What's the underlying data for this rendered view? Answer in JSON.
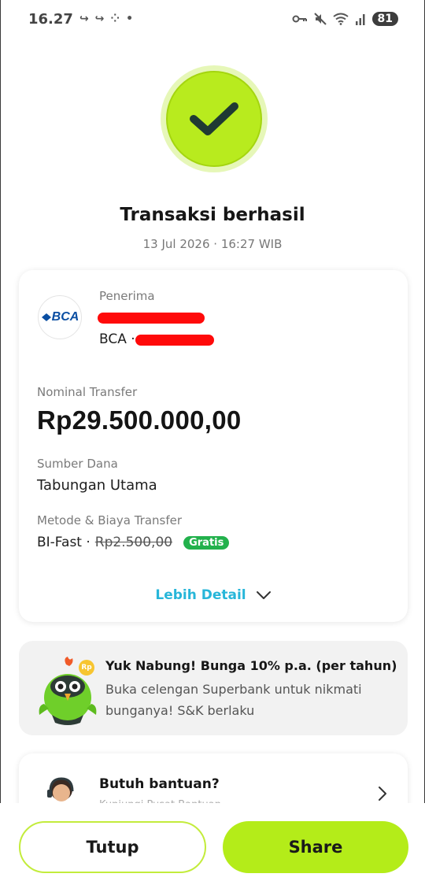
{
  "status_bar": {
    "time": "16.27",
    "battery": "81"
  },
  "result": {
    "title": "Transaksi berhasil",
    "datetime": "13 Jul 2026 · 16:27 WIB"
  },
  "recipient": {
    "label": "Penerima",
    "bank_logo_text": "BCA",
    "bank_prefix": "BCA ·"
  },
  "transfer": {
    "amount_label": "Nominal Transfer",
    "amount": "Rp29.500.000,00",
    "source_label": "Sumber Dana",
    "source": "Tabungan Utama",
    "method_label": "Metode & Biaya Transfer",
    "method": "BI-Fast ·",
    "fee_original": "Rp2.500,00",
    "fee_badge": "Gratis",
    "more_detail": "Lebih Detail"
  },
  "promo": {
    "title": "Yuk Nabung! Bunga 10% p.a. (per tahun)",
    "body": "Buka celengan Superbank untuk nikmati bunganya! S&K berlaku",
    "badge": "Rp"
  },
  "help": {
    "title": "Butuh bantuan?",
    "subtitle": "Kunjungi Pusat Bantuan"
  },
  "actions": {
    "close_label": "Tutup",
    "share_label": "Share"
  },
  "colors": {
    "accent_lime": "#b4ec19",
    "link_cyan": "#27b6d9",
    "badge_green": "#22b14c",
    "redaction_red": "#ff0a0a"
  }
}
